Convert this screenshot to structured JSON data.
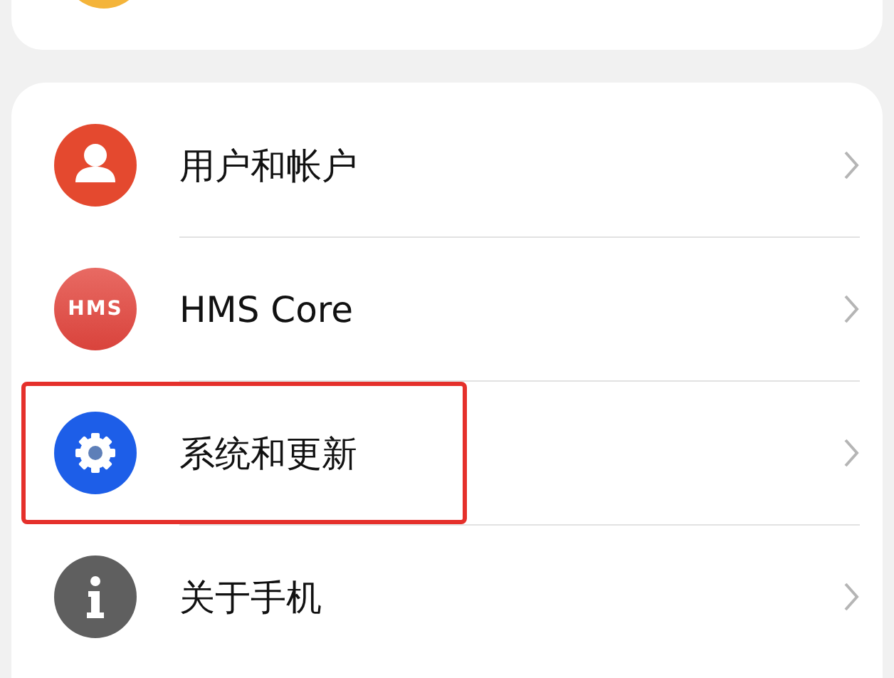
{
  "rows": [
    {
      "kind": "account",
      "label": "用户和帐户",
      "highlighted": false
    },
    {
      "kind": "hms",
      "label": "HMS Core",
      "logo_text": "HMS",
      "highlighted": false
    },
    {
      "kind": "system",
      "label": "系统和更新",
      "highlighted": true
    },
    {
      "kind": "about",
      "label": "关于手机",
      "highlighted": false
    }
  ]
}
